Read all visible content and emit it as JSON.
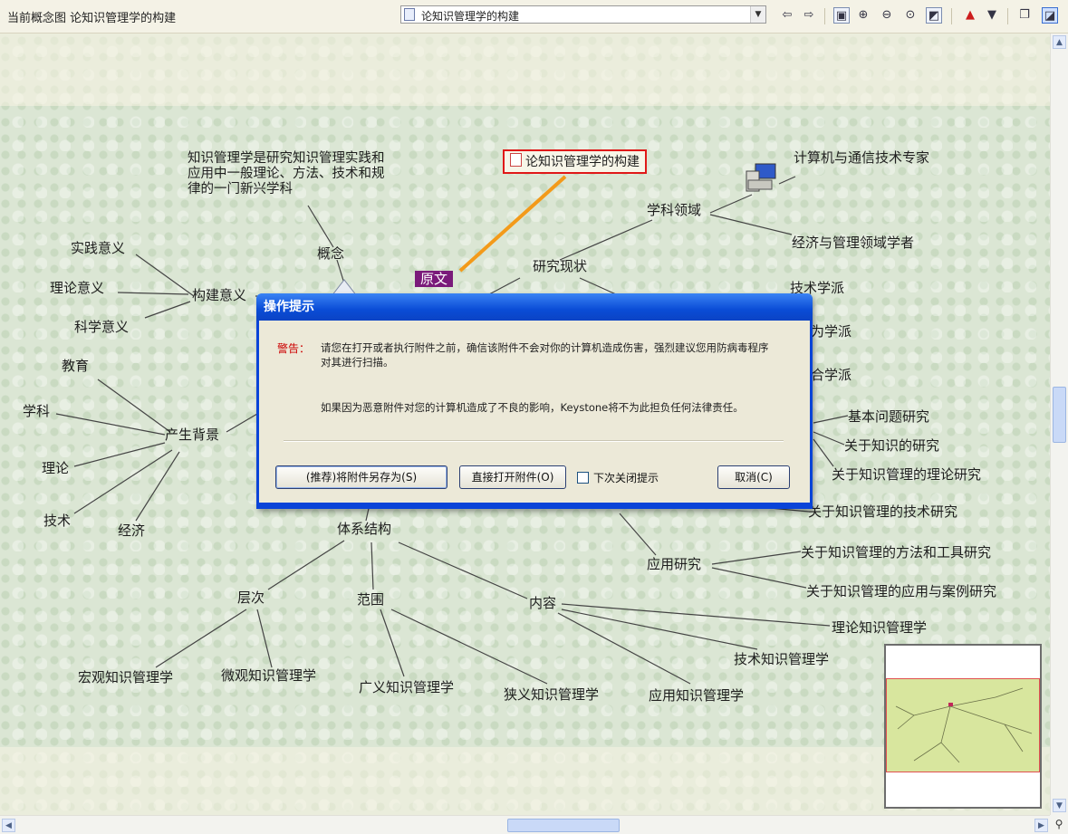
{
  "toolbar": {
    "map_title": "当前概念图 论知识管理学的构建",
    "selector_value": "论知识管理学的构建"
  },
  "map": {
    "root": "论知识管理学的构建",
    "original_tag": "原文",
    "definition": "知识管理学是研究知识管理实践和应用中一般理论、方法、技术和规律的一门新兴学科",
    "concept": "概念",
    "significance": {
      "label": "构建意义",
      "items": [
        "实践意义",
        "理论意义",
        "科学意义"
      ]
    },
    "background": {
      "label": "产生背景",
      "items": [
        "教育",
        "学科",
        "理论",
        "技术",
        "经济"
      ]
    },
    "status": {
      "label": "研究现状",
      "field": "学科领域",
      "field_items": [
        "计算机与通信技术专家",
        "经济与管理领域学者"
      ],
      "schools": [
        "技术学派",
        "行为学派",
        "综合学派"
      ]
    },
    "research": {
      "items": [
        "基本问题研究",
        "关于知识的研究",
        "关于知识管理的理论研究",
        "关于知识管理的技术研究",
        "关于知识管理的方法和工具研究",
        "关于知识管理的应用与案例研究"
      ],
      "applied": "应用研究"
    },
    "structure": {
      "label": "体系结构",
      "levels": {
        "label": "层次",
        "items": [
          "宏观知识管理学",
          "微观知识管理学"
        ]
      },
      "scope": {
        "label": "范围",
        "items": [
          "广义知识管理学",
          "狭义知识管理学"
        ]
      },
      "content": {
        "label": "内容",
        "items": [
          "理论知识管理学",
          "技术知识管理学",
          "应用知识管理学"
        ]
      }
    }
  },
  "dialog": {
    "title": "操作提示",
    "warning_label": "警告：",
    "warning_text": "请您在打开或者执行附件之前，确信该附件不会对你的计算机造成伤害，强烈建议您用防病毒程序对其进行扫描。",
    "disclaimer": "如果因为恶意附件对您的计算机造成了不良的影响，Keystone将不为此担负任何法律责任。",
    "btn_save": "(推荐)将附件另存为(S)",
    "btn_open": "直接打开附件(O)",
    "checkbox_label": "下次关闭提示",
    "btn_cancel": "取消(C)"
  },
  "colors": {
    "root_border": "#e01818",
    "root_link": "#f39a1a",
    "original_tag_bg": "#7a1a7a",
    "dialog_title": "#0a44d8",
    "warning": "#cc0000"
  }
}
